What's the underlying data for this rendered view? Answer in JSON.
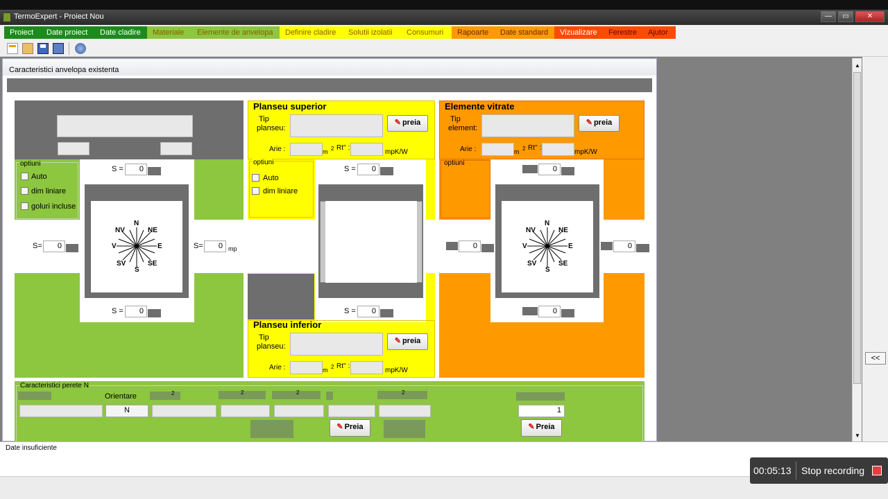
{
  "window": {
    "title": "TermoExpert - Proiect Nou",
    "minimize": "—",
    "restore": "▭",
    "close": "✕"
  },
  "menu": [
    {
      "label": "Proiect",
      "bg": "#1e8a1e",
      "fg": "#ffffff"
    },
    {
      "label": "Date proiect",
      "bg": "#1e8a1e",
      "fg": "#ffffff"
    },
    {
      "label": "Date cladire",
      "bg": "#1e8a1e",
      "fg": "#ffffff"
    },
    {
      "label": "Materiale",
      "bg": "#8dc63f",
      "fg": "#8a5a00"
    },
    {
      "label": "Elemente de anvelopa",
      "bg": "#8dc63f",
      "fg": "#8a5a00"
    },
    {
      "label": "Definire cladire",
      "bg": "#ffff00",
      "fg": "#8a5a00"
    },
    {
      "label": "Solutii izolatii",
      "bg": "#ffff00",
      "fg": "#8a5a00"
    },
    {
      "label": "Consumuri",
      "bg": "#ffff00",
      "fg": "#8a5a00"
    },
    {
      "label": "Rapoarte",
      "bg": "#ff9900",
      "fg": "#6a2a00"
    },
    {
      "label": "Date standard",
      "bg": "#ff9900",
      "fg": "#6a2a00"
    },
    {
      "label": "Vizualizare",
      "bg": "#ff4a00",
      "fg": "#ffffff"
    },
    {
      "label": "Ferestre",
      "bg": "#ff4a00",
      "fg": "#6a0000"
    },
    {
      "label": "Ajutor",
      "bg": "#ff4a00",
      "fg": "#6a0000"
    }
  ],
  "child_title": "Caracteristici anvelopa existenta",
  "left_options": {
    "title": "optiuni",
    "items": [
      "Auto",
      "dim liniare",
      "goluri incluse"
    ]
  },
  "mid_options": {
    "title": "optiuni",
    "items": [
      "Auto",
      "dim liniare"
    ]
  },
  "right_options": {
    "title": "optiuni"
  },
  "s_label": "S =",
  "s_label_left": "S=",
  "s_label_right": "S=",
  "zero": "0",
  "mp": "mp",
  "compass": {
    "n": "N",
    "ne": "NE",
    "e": "E",
    "se": "SE",
    "s": "S",
    "sv": "SV",
    "v": "V",
    "nv": "NV"
  },
  "planseu_superior": {
    "title": "Planseu superior",
    "tip": "Tip",
    "planseu": "planseu:",
    "arie": "Arie :",
    "m": "m",
    "two": "2",
    "rt": "Rt'' :",
    "unit": "mpK/W",
    "button": "preia"
  },
  "planseu_inferior": {
    "title": "Planseu inferior",
    "tip": "Tip",
    "planseu": "planseu:",
    "arie": "Arie :",
    "m": "m",
    "two": "2",
    "rt": "Rt'' :",
    "unit": "mpK/W",
    "button": "preia"
  },
  "elemente_vitrate": {
    "title": "Elemente vitrate",
    "tip": "Tip",
    "element": "element:",
    "arie": "Arie :",
    "m": "m",
    "two": "2",
    "rt": "Rt'' :",
    "unit": "mpK/W",
    "button": "preia"
  },
  "perete": {
    "title": "Caracteristici perete N",
    "orientare": "Orientare",
    "orient_value": "N",
    "count_value": "1",
    "two": "2",
    "preia1": "Preia",
    "preia2": "Preia"
  },
  "collapse": "<<",
  "status": "Date insuficiente",
  "recording": {
    "time": "00:05:13",
    "label": "Stop recording"
  }
}
